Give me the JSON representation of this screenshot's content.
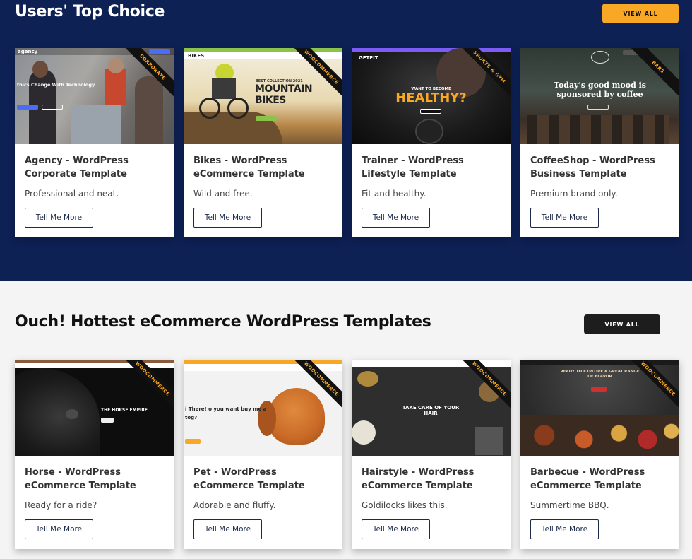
{
  "top": {
    "title": "Users' Top Choice",
    "view_all": "VIEW ALL",
    "cards": [
      {
        "title": "Agency - WordPress Corporate Template",
        "desc": "Professional and neat.",
        "button": "Tell Me More",
        "ribbon": "CORPORATE",
        "thumb_brand": "agency",
        "thumb_headline": "thics Change With Technology"
      },
      {
        "title": "Bikes - WordPress eCommerce Template",
        "desc": "Wild and free.",
        "button": "Tell Me More",
        "ribbon": "WOOCOMMERCE",
        "thumb_brand": "BIKES",
        "thumb_headline": "MOUNTAIN BIKES",
        "thumb_sub": "BEST COLLECTION 2021"
      },
      {
        "title": "Trainer - WordPress Lifestyle Template",
        "desc": "Fit and healthy.",
        "button": "Tell Me More",
        "ribbon": "SPORTS & GYM",
        "thumb_brand": "GETFIT",
        "thumb_headline": "HEALTHY?",
        "thumb_sub": "WANT TO BECOME"
      },
      {
        "title": "CoffeeShop - WordPress Business Template",
        "desc": "Premium brand only.",
        "button": "Tell Me More",
        "ribbon": "BARS",
        "thumb_headline": "Today's good mood is sponsored by coffee"
      }
    ]
  },
  "bottom": {
    "title": "Ouch! Hottest eCommerce WordPress Templates",
    "view_all": "VIEW ALL",
    "cards": [
      {
        "title": "Horse - WordPress eCommerce Template",
        "desc": "Ready for a ride?",
        "button": "Tell Me More",
        "ribbon": "WOOCOMMERCE",
        "thumb_headline": "THE HORSE EMPIRE"
      },
      {
        "title": "Pet - WordPress eCommerce Template",
        "desc": "Adorable and fluffy.",
        "button": "Tell Me More",
        "ribbon": "WOOCOMMERCE",
        "thumb_headline": "i There! o you want buy me a tog?"
      },
      {
        "title": "Hairstyle - WordPress eCommerce Template",
        "desc": "Goldilocks likes this.",
        "button": "Tell Me More",
        "ribbon": "WOOCOMMERCE",
        "thumb_headline": "TAKE CARE OF YOUR HAIR"
      },
      {
        "title": "Barbecue - WordPress eCommerce Template",
        "desc": "Summertime BBQ.",
        "button": "Tell Me More",
        "ribbon": "WOOCOMMERCE",
        "thumb_headline": "READY TO EXPLORE A GREAT RANGE OF FLAVOR"
      }
    ]
  },
  "colors": {
    "navy": "#0e2155",
    "accent": "#f9a825"
  }
}
